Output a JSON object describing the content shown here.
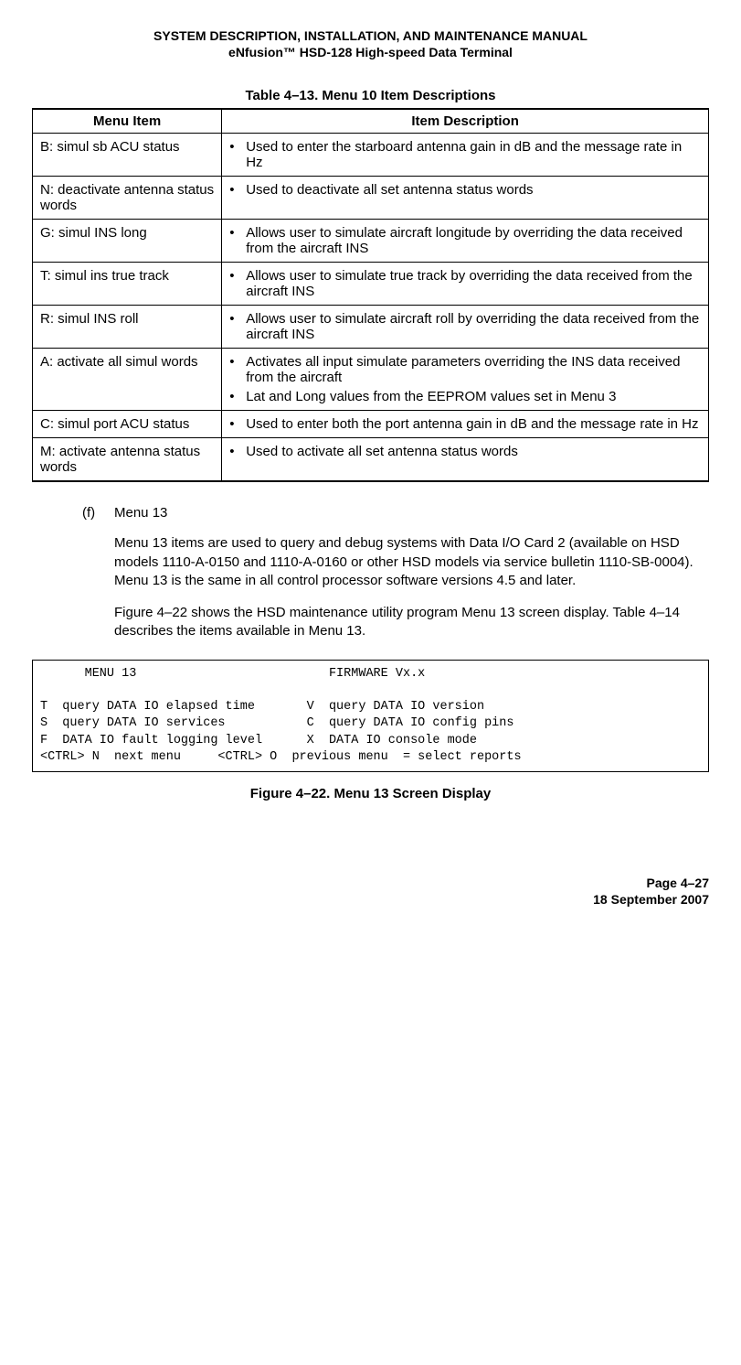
{
  "header": {
    "line1": "SYSTEM DESCRIPTION, INSTALLATION, AND MAINTENANCE MANUAL",
    "line2": "eNfusion™ HSD-128 High-speed Data Terminal"
  },
  "table": {
    "caption": "Table 4–13. Menu 10 Item Descriptions",
    "col1": "Menu Item",
    "col2": "Item Description",
    "rows": [
      {
        "item": "B: simul sb ACU status",
        "bullets": [
          "Used to enter the starboard antenna gain in dB and the message rate in Hz"
        ]
      },
      {
        "item": "N: deactivate antenna status    words",
        "bullets": [
          "Used to deactivate all set antenna status words"
        ]
      },
      {
        "item": "G: simul INS long",
        "bullets": [
          "Allows user to simulate aircraft longitude by overriding the data received from the aircraft INS"
        ]
      },
      {
        "item": "T: simul ins true track",
        "bullets": [
          "Allows user to simulate true track by overriding the data received from the aircraft INS"
        ]
      },
      {
        "item": "R: simul INS roll",
        "bullets": [
          "Allows user to simulate aircraft roll by overriding the data received from the aircraft INS"
        ]
      },
      {
        "item": "A: activate all simul words",
        "bullets": [
          "Activates all input simulate parameters overriding the INS data received from the aircraft",
          "Lat and Long values from the EEPROM values set in Menu 3"
        ]
      },
      {
        "item": "C: simul port ACU status",
        "bullets": [
          "Used to enter both the port antenna gain in dB and the message rate in Hz"
        ]
      },
      {
        "item": "M: activate antenna status words",
        "bullets": [
          "Used to activate all set antenna status words"
        ]
      }
    ]
  },
  "section": {
    "label": "(f)",
    "title": "Menu 13",
    "para1": "Menu 13 items are used to query and debug systems with Data I/O Card 2 (available on HSD models 1110-A-0150 and 1110-A-0160 or other HSD models via service bulletin 1110-SB-0004). Menu 13 is the same in all control processor software versions 4.5 and later.",
    "para2": "Figure 4–22 shows the HSD maintenance utility program Menu 13 screen display. Table 4–14 describes the items available in Menu 13."
  },
  "screen": "      MENU 13                          FIRMWARE Vx.x\n\nT  query DATA IO elapsed time       V  query DATA IO version\nS  query DATA IO services           C  query DATA IO config pins\nF  DATA IO fault logging level      X  DATA IO console mode\n<CTRL> N  next menu     <CTRL> O  previous menu  = select reports",
  "figure_caption": "Figure 4–22. Menu 13 Screen Display",
  "footer": {
    "page": "Page 4–27",
    "date": "18 September 2007"
  }
}
